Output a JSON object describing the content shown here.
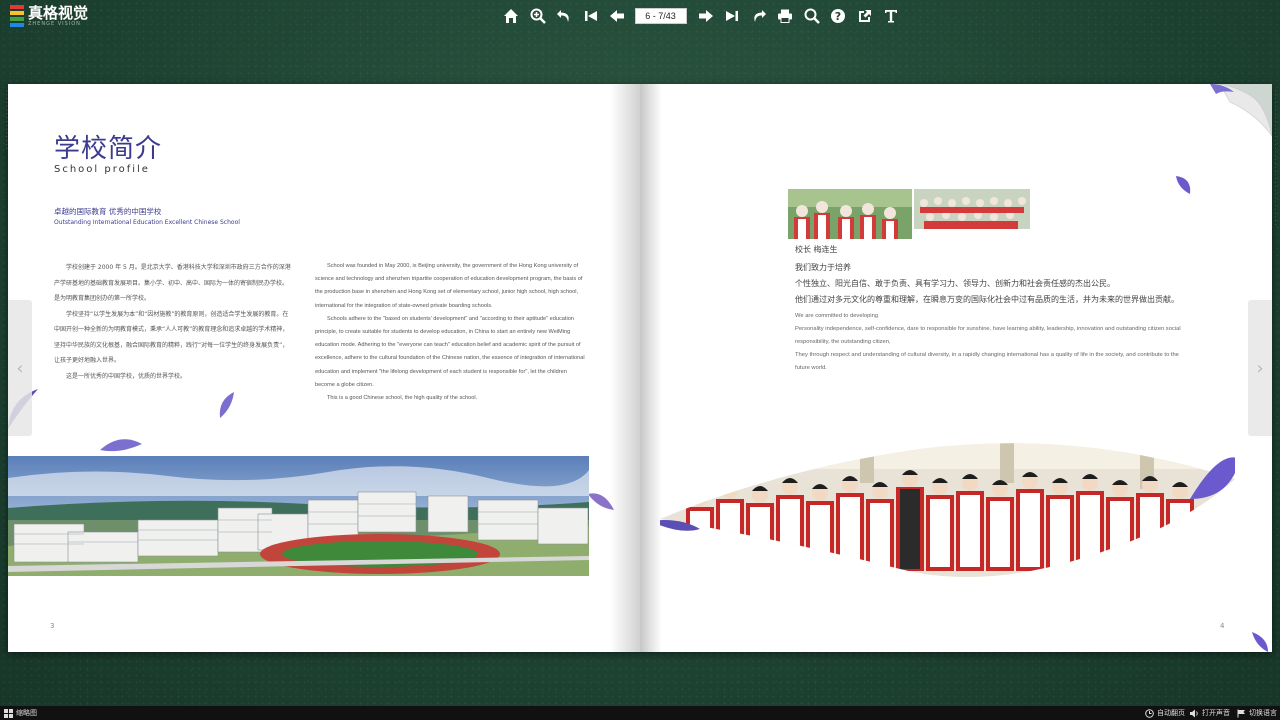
{
  "app": {
    "logo_text": "真格视觉",
    "logo_sub": "ZHENGE VISION",
    "logo_colors": [
      "#e53935",
      "#fbc02d",
      "#43a047",
      "#1e88e5"
    ]
  },
  "toolbar": {
    "page_indicator": "6 - 7/43",
    "icons": [
      "home-icon",
      "zoom-in-icon",
      "undo-icon",
      "first-page-icon",
      "prev-page-icon",
      "next-page-icon",
      "last-page-icon",
      "share-icon",
      "print-icon",
      "search-icon",
      "help-icon",
      "export-icon",
      "text-icon"
    ]
  },
  "left_page": {
    "title_cn": "学校简介",
    "title_en": "School profile",
    "slogan_cn": "卓越的国际教育  优秀的中国学校",
    "slogan_en": "Outstanding International Education   Excellent Chinese School",
    "cn_paragraphs": [
      "学校创建于 2000 年 5 月。是北京大学、香港科技大学和深圳市政府三方合作的深港产学研基地的基础教育发展项目。集小学、初中、高中、国际为一体的寄宿制民办学校。是为明教育集团创办的第一所学校。",
      "学校坚持“以学生发展为本”和“因材施教”的教育原则，创造适合学生发展的教育。在中国开创一种全新的为明教育模式，秉承“人人可教”的教育理念和追求卓越的学术精神，坚持中华民族的文化根基，融合国际教育的精粹，践行“对每一位学生的终身发展负责”，让孩子更好地融入世界。",
      "这是一所优秀的中国学校，优质的世界学校。"
    ],
    "en_paragraphs": [
      "School was founded in May 2000, is Beijing university, the government of the Hong Kong university of science and technology and shenzhen tripartite cooperation of education development program, the basis of the production base in shenzhen and Hong Kong set of elementary school, junior high school, high school, international for the integration of state-owned private boarding schools.",
      "Schools adhere to the \"based on students' development\" and \"according to their aptitude\" education principle, to create suitable for students to develop education, in China to start an entirely new WeiMing education mode. Adhering to the \"everyone can teach\" education belief and academic spirit of the pursuit of excellence, adhere to the cultural foundation of the Chinese nation, the essence of integration of international education and implement \"the lifelong development of each student is responsible for\", let the children become a globe citizen.",
      "This is a good Chinese school, the high quality of the school."
    ],
    "page_number": "3"
  },
  "right_page": {
    "principal": "校长    梅连生",
    "cn_lines": [
      "我们致力于培养",
      "个性独立、阳光自信、敢于负责、具有学习力、领导力、创新力和社会责任感的杰出公民。",
      "他们通过对多元文化的尊重和理解，在瞬息万变的国际化社会中过有品质的生活，并为未来的世界做出贡献。"
    ],
    "en_lines": [
      "We are committed to developing",
      "Personality independence, self-confidence, dare to responsible for sunshine, have learning ability, leadership, innovation and outstanding citizen social responsibility, the outstanding citizen,",
      "They through respect and understanding of cultural diversity, in a rapidly changing international has a quality of life in the society, and contribute to the future world."
    ],
    "page_number": "4"
  },
  "bottombar": {
    "thumbnails": "缩略图",
    "autoflip": "自动翻页",
    "sound": "打开声音",
    "language": "切换语言"
  },
  "colors": {
    "accent": "#3b3a8f",
    "petal": "#6a5acd",
    "background": "#1f4534"
  }
}
